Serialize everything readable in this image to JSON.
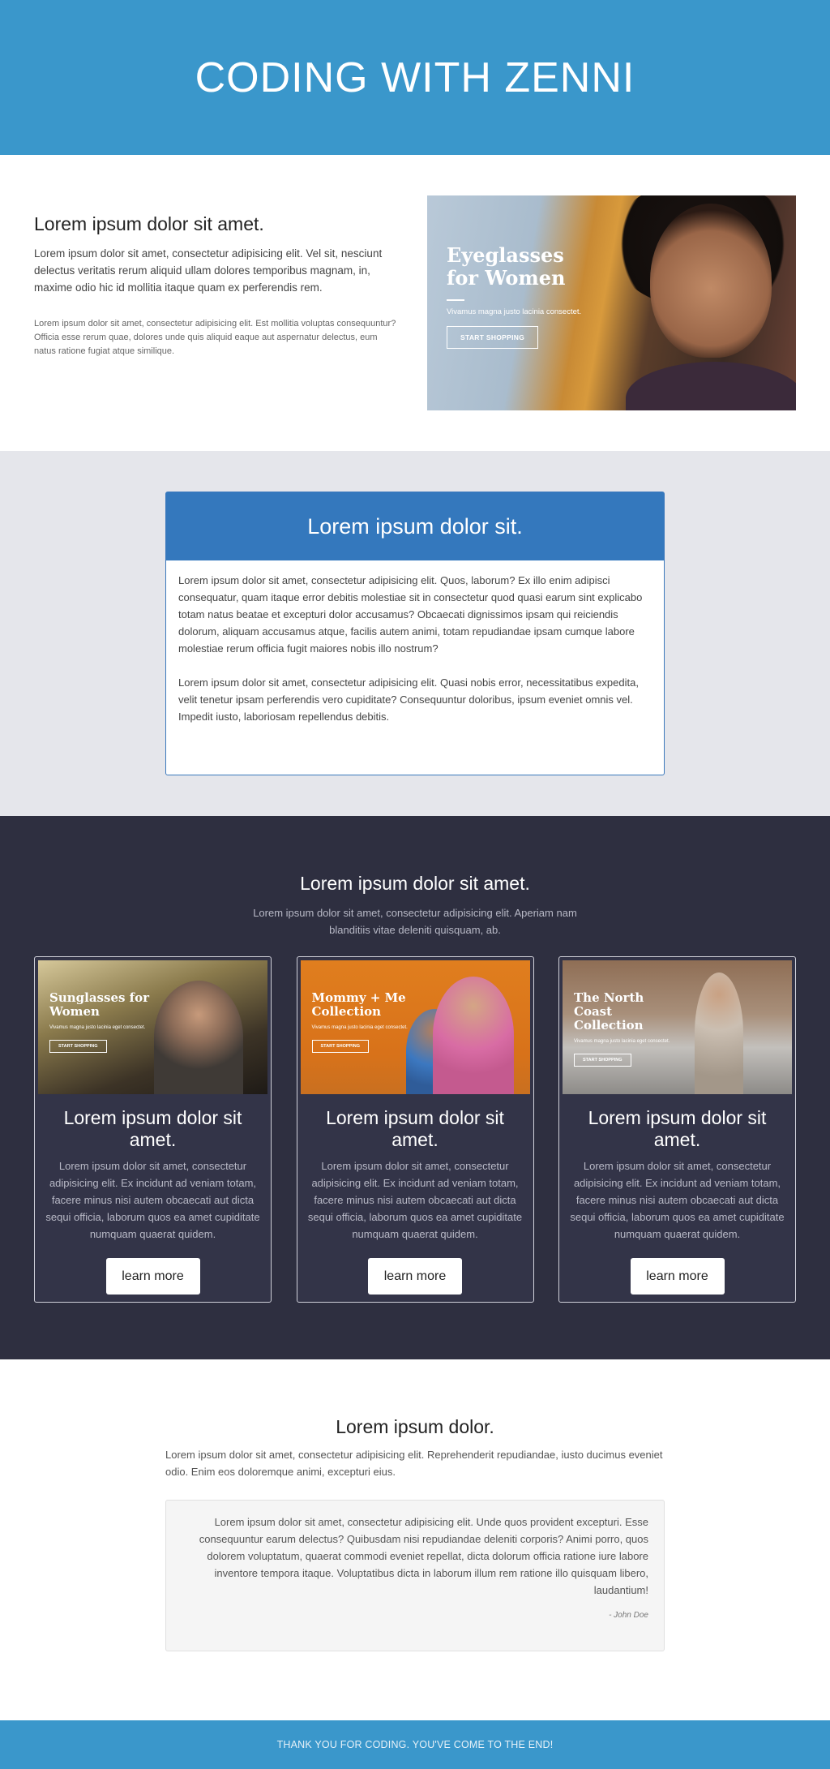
{
  "header": {
    "title": "CODING WITH ZENNI"
  },
  "intro": {
    "heading": "Lorem ipsum dolor sit amet.",
    "lead": "Lorem ipsum dolor sit amet, consectetur adipisicing elit. Vel sit, nesciunt delectus veritatis rerum aliquid ullam dolores temporibus magnam, in, maxime odio hic id mollitia itaque quam ex perferendis rem.",
    "small": "Lorem ipsum dolor sit amet, consectetur adipisicing elit. Est mollitia voluptas consequuntur? Officia esse rerum quae, dolores unde quis aliquid eaque aut aspernatur delectus, eum natus ratione fugiat atque similique.",
    "banner": {
      "title": "Eyeglasses for Women",
      "sub": "Vivamus magna justo lacinia consectet.",
      "button": "START SHOPPING"
    }
  },
  "panel": {
    "title": "Lorem ipsum dolor sit.",
    "paragraphs": [
      "Lorem ipsum dolor sit amet, consectetur adipisicing elit. Quos, laborum? Ex illo enim adipisci consequatur, quam itaque error debitis molestiae sit in consectetur quod quasi earum sint explicabo totam natus beatae et excepturi dolor accusamus? Obcaecati dignissimos ipsam qui reiciendis dolorum, aliquam accusamus atque, facilis autem animi, totam repudiandae ipsam cumque labore molestiae rerum officia fugit maiores nobis illo nostrum?",
      "Lorem ipsum dolor sit amet, consectetur adipisicing elit. Quasi nobis error, necessitatibus expedita, velit tenetur ipsam perferendis vero cupiditate? Consequuntur doloribus, ipsum eveniet omnis vel. Impedit iusto, laboriosam repellendus debitis."
    ]
  },
  "features": {
    "title": "Lorem ipsum dolor sit amet.",
    "subtitle": "Lorem ipsum dolor sit amet, consectetur adipisicing elit. Aperiam nam blanditiis vitae deleniti quisquam, ab.",
    "cards": [
      {
        "image_title": "Sunglasses for Women",
        "image_sub": "Vivamus magna justo lacinia eget consectet.",
        "image_button": "START SHOPPING",
        "title": "Lorem ipsum dolor sit amet.",
        "text": "Lorem ipsum dolor sit amet, consectetur adipisicing elit. Ex incidunt ad veniam totam, facere minus nisi autem obcaecati aut dicta sequi officia, laborum quos ea amet cupiditate numquam quaerat quidem.",
        "button": "learn more"
      },
      {
        "image_title": "Mommy + Me Collection",
        "image_sub": "Vivamus magna justo lacinia eget consectet.",
        "image_button": "START SHOPPING",
        "title": "Lorem ipsum dolor sit amet.",
        "text": "Lorem ipsum dolor sit amet, consectetur adipisicing elit. Ex incidunt ad veniam totam, facere minus nisi autem obcaecati aut dicta sequi officia, laborum quos ea amet cupiditate numquam quaerat quidem.",
        "button": "learn more"
      },
      {
        "image_title": "The North Coast Collection",
        "image_sub": "Vivamus magna justo lacinia eget consectet.",
        "image_button": "START SHOPPING",
        "title": "Lorem ipsum dolor sit amet.",
        "text": "Lorem ipsum dolor sit amet, consectetur adipisicing elit. Ex incidunt ad veniam totam, facere minus nisi autem obcaecati aut dicta sequi officia, laborum quos ea amet cupiditate numquam quaerat quidem.",
        "button": "learn more"
      }
    ]
  },
  "testimonial": {
    "title": "Lorem ipsum dolor.",
    "subtitle": "Lorem ipsum dolor sit amet, consectetur adipisicing elit. Reprehenderit repudiandae, iusto ducimus eveniet odio. Enim eos doloremque animi, excepturi eius.",
    "quote": "Lorem ipsum dolor sit amet, consectetur adipisicing elit. Unde quos provident excepturi. Esse consequuntur earum delectus? Quibusdam nisi repudiandae deleniti corporis? Animi porro, quos dolorem voluptatum, quaerat commodi eveniet repellat, dicta dolorum officia ratione iure labore inventore tempora itaque. Voluptatibus dicta in laborum illum rem ratione illo quisquam libero, laudantium!",
    "author": "- John Doe"
  },
  "footer": {
    "text": "THANK YOU FOR CODING. YOU'VE COME TO THE END!"
  },
  "colors": {
    "header": "#3a97cb",
    "panel_header": "#3478bd",
    "dark_bg": "#2e2f40",
    "gray_bg": "#e5e6eb"
  }
}
